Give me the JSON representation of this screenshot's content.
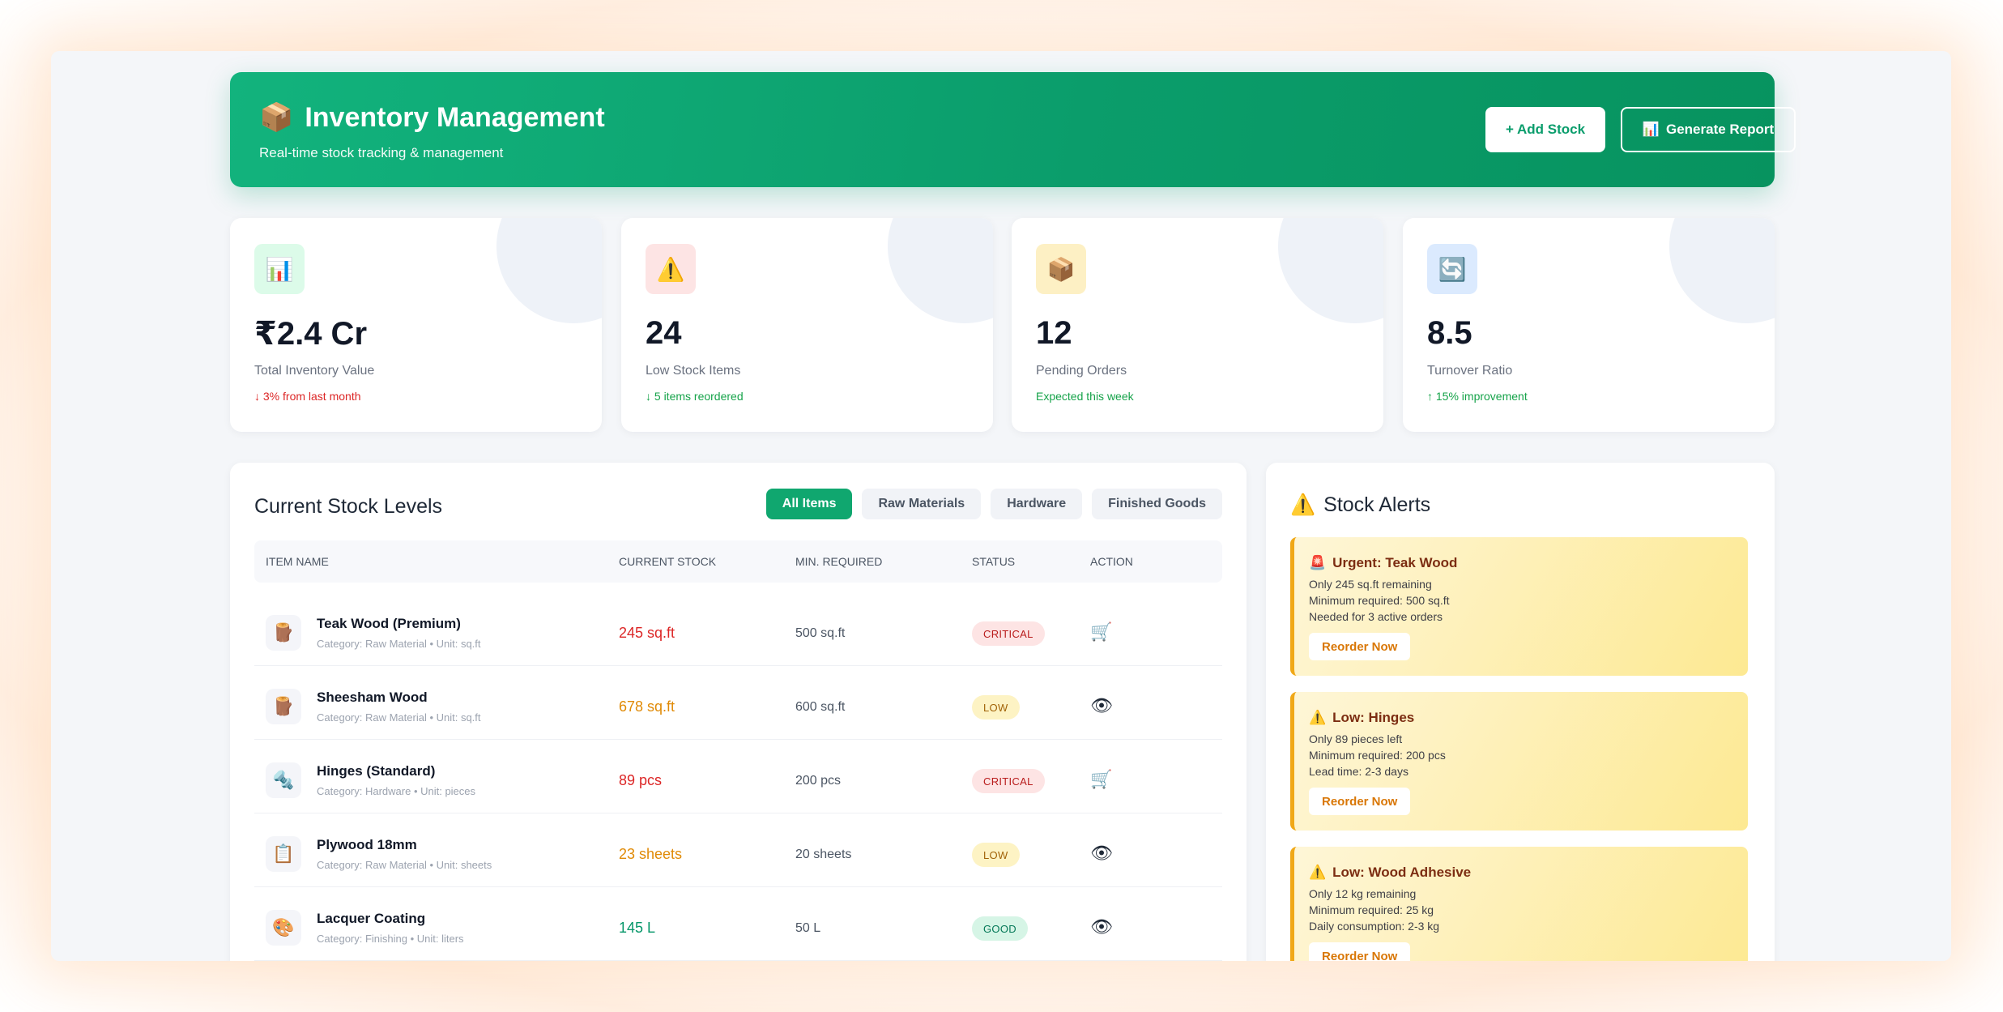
{
  "header": {
    "icon": "package-icon",
    "title": "Inventory Management",
    "subtitle": "Real-time stock tracking & management",
    "add_label": "+ Add Stock",
    "report_label": "Generate Report"
  },
  "stats": [
    {
      "icon": "bar-chart-icon",
      "value": "₹2.4 Cr",
      "label": "Total Inventory Value",
      "trend": "↓ 3% from last month",
      "trend_color": "#dc2626",
      "icon_bg": "#dcfbe9"
    },
    {
      "icon": "warning-icon",
      "value": "24",
      "label": "Low Stock Items",
      "trend": "↓ 5 items reordered",
      "trend_color": "#16a34a",
      "icon_bg": "#fde4e4"
    },
    {
      "icon": "package-icon",
      "value": "12",
      "label": "Pending Orders",
      "trend": "Expected this week",
      "trend_color": "#16a34a",
      "icon_bg": "#fdf0c4"
    },
    {
      "icon": "refresh-icon",
      "value": "8.5",
      "label": "Turnover Ratio",
      "trend": "↑ 15% improvement",
      "trend_color": "#16a34a",
      "icon_bg": "#dbeafe"
    }
  ],
  "stock": {
    "title": "Current Stock Levels",
    "filters": [
      "All Items",
      "Raw Materials",
      "Hardware",
      "Finished Goods"
    ],
    "columns": [
      "Item Name",
      "Current Stock",
      "Min. Required",
      "Status",
      "Action"
    ],
    "rows": [
      {
        "icon": "wood-log-icon",
        "glyph": "🪵",
        "name": "Teak Wood (Premium)",
        "meta": "Category: Raw Material • Unit: sq.ft",
        "current": "245 sq.ft",
        "level": "red",
        "min": "500 sq.ft",
        "status": "CRITICAL",
        "status_class": "critical",
        "action": "cart-icon",
        "action_glyph": "🛒"
      },
      {
        "icon": "wood-log-icon",
        "glyph": "🪵",
        "name": "Sheesham Wood",
        "meta": "Category: Raw Material • Unit: sq.ft",
        "current": "678 sq.ft",
        "level": "amber",
        "min": "600 sq.ft",
        "status": "LOW",
        "status_class": "low",
        "action": "eye-icon",
        "action_glyph": "👁"
      },
      {
        "icon": "nut-bolt-icon",
        "glyph": "🔩",
        "name": "Hinges (Standard)",
        "meta": "Category: Hardware • Unit: pieces",
        "current": "89 pcs",
        "level": "red",
        "min": "200 pcs",
        "status": "CRITICAL",
        "status_class": "critical",
        "action": "cart-icon",
        "action_glyph": "🛒"
      },
      {
        "icon": "clipboard-icon",
        "glyph": "📋",
        "name": "Plywood 18mm",
        "meta": "Category: Raw Material • Unit: sheets",
        "current": "23 sheets",
        "level": "amber",
        "min": "20 sheets",
        "status": "LOW",
        "status_class": "low",
        "action": "eye-icon",
        "action_glyph": "👁"
      },
      {
        "icon": "palette-icon",
        "glyph": "🎨",
        "name": "Lacquer Coating",
        "meta": "Category: Finishing • Unit: liters",
        "current": "145 L",
        "level": "green",
        "min": "50 L",
        "status": "GOOD",
        "status_class": "good",
        "action": "eye-icon",
        "action_glyph": "👁"
      }
    ]
  },
  "alerts": {
    "title": "Stock Alerts",
    "icon": "warning-icon",
    "items": [
      {
        "icon": "siren-icon",
        "glyph": "🚨",
        "title": "Urgent: Teak Wood",
        "lines": [
          "Only 245 sq.ft remaining",
          "Minimum required: 500 sq.ft",
          "Needed for 3 active orders"
        ],
        "button": "Reorder Now"
      },
      {
        "icon": "warning-icon",
        "glyph": "⚠️",
        "title": "Low: Hinges",
        "lines": [
          "Only 89 pieces left",
          "Minimum required: 200 pcs",
          "Lead time: 2-3 days"
        ],
        "button": "Reorder Now"
      },
      {
        "icon": "warning-icon",
        "glyph": "⚠️",
        "title": "Low: Wood Adhesive",
        "lines": [
          "Only 12 kg remaining",
          "Minimum required: 25 kg",
          "Daily consumption: 2-3 kg"
        ],
        "button": "Reorder Now"
      }
    ]
  }
}
